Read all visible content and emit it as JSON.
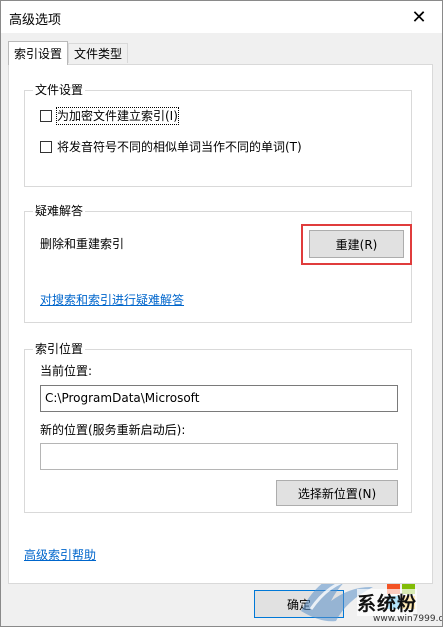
{
  "window": {
    "title": "高级选项",
    "close_glyph": "✕"
  },
  "tabs": [
    {
      "label": "索引设置",
      "active": true
    },
    {
      "label": "文件类型",
      "active": false
    }
  ],
  "file_settings": {
    "title": "文件设置",
    "options": [
      {
        "label": "为加密文件建立索引(I)",
        "checked": false
      },
      {
        "label": "将发音符号不同的相似单词当作不同的单词(T)",
        "checked": false
      }
    ]
  },
  "troubleshoot": {
    "title": "疑难解答",
    "rebuild_label": "删除和重建索引",
    "rebuild_button": "重建(R)",
    "link": "对搜索和索引进行疑难解答",
    "highlight_color": "#e03c3c"
  },
  "index_location": {
    "title": "索引位置",
    "current_label": "当前位置:",
    "current_value": "C:\\ProgramData\\Microsoft",
    "new_label": "新的位置(服务重新启动后):",
    "new_value": "",
    "select_button": "选择新位置(N)"
  },
  "footer": {
    "help_link": "高级索引帮助",
    "ok_button": "确定"
  },
  "watermark": {
    "brand": "系统粉",
    "url": "www.win7999.com"
  },
  "colors": {
    "link": "#0066cc",
    "panel_bg": "#f0f0f0"
  }
}
